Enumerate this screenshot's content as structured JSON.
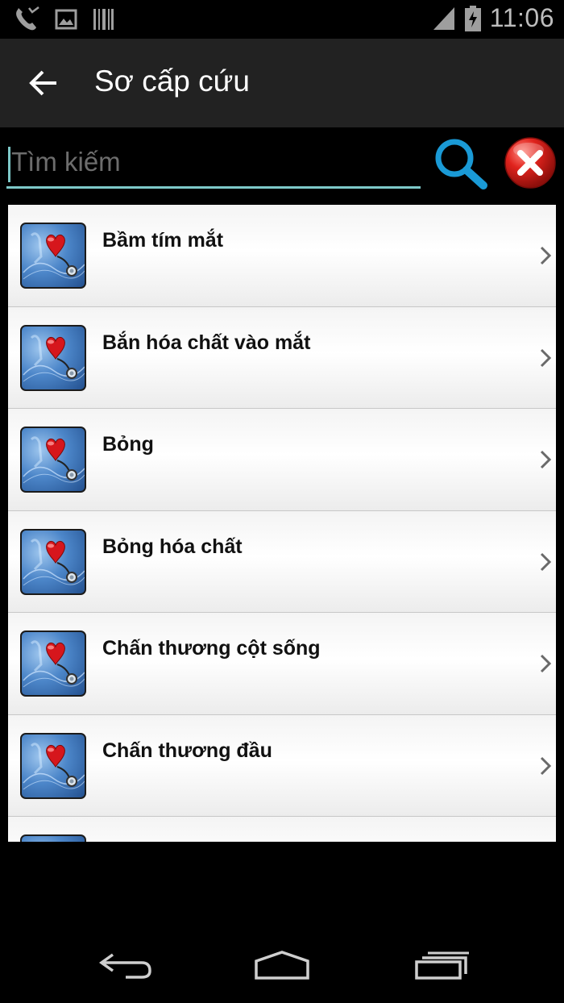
{
  "status_bar": {
    "time": "11:06",
    "left_icons": [
      "missed-call-icon",
      "image-icon",
      "barcode-icon"
    ],
    "right_icons": [
      "signal-icon",
      "battery-charging-icon"
    ]
  },
  "action_bar": {
    "title": "Sơ cấp cứu",
    "back_icon": "arrow-left-icon"
  },
  "search": {
    "placeholder": "Tìm kiếm",
    "value": "",
    "search_icon": "magnifier-icon",
    "clear_icon": "red-x-icon"
  },
  "list": {
    "items": [
      {
        "title": "Bầm tím mắt",
        "icon": "heart-stethoscope-icon"
      },
      {
        "title": "Bắn hóa chất vào mắt",
        "icon": "heart-stethoscope-icon"
      },
      {
        "title": "Bỏng",
        "icon": "heart-stethoscope-icon"
      },
      {
        "title": "Bỏng hóa chất",
        "icon": "heart-stethoscope-icon"
      },
      {
        "title": "Chấn thương cột sống",
        "icon": "heart-stethoscope-icon"
      },
      {
        "title": "Chấn thương đầu",
        "icon": "heart-stethoscope-icon"
      },
      {
        "title": "",
        "icon": "heart-stethoscope-icon"
      }
    ]
  },
  "nav_bar": {
    "buttons": [
      "back-icon",
      "home-icon",
      "recents-icon"
    ]
  },
  "colors": {
    "action_bar_bg": "#222222",
    "search_underline": "#7ec9c9",
    "search_icon": "#1a9ad6",
    "clear_icon": "#e0231d"
  }
}
